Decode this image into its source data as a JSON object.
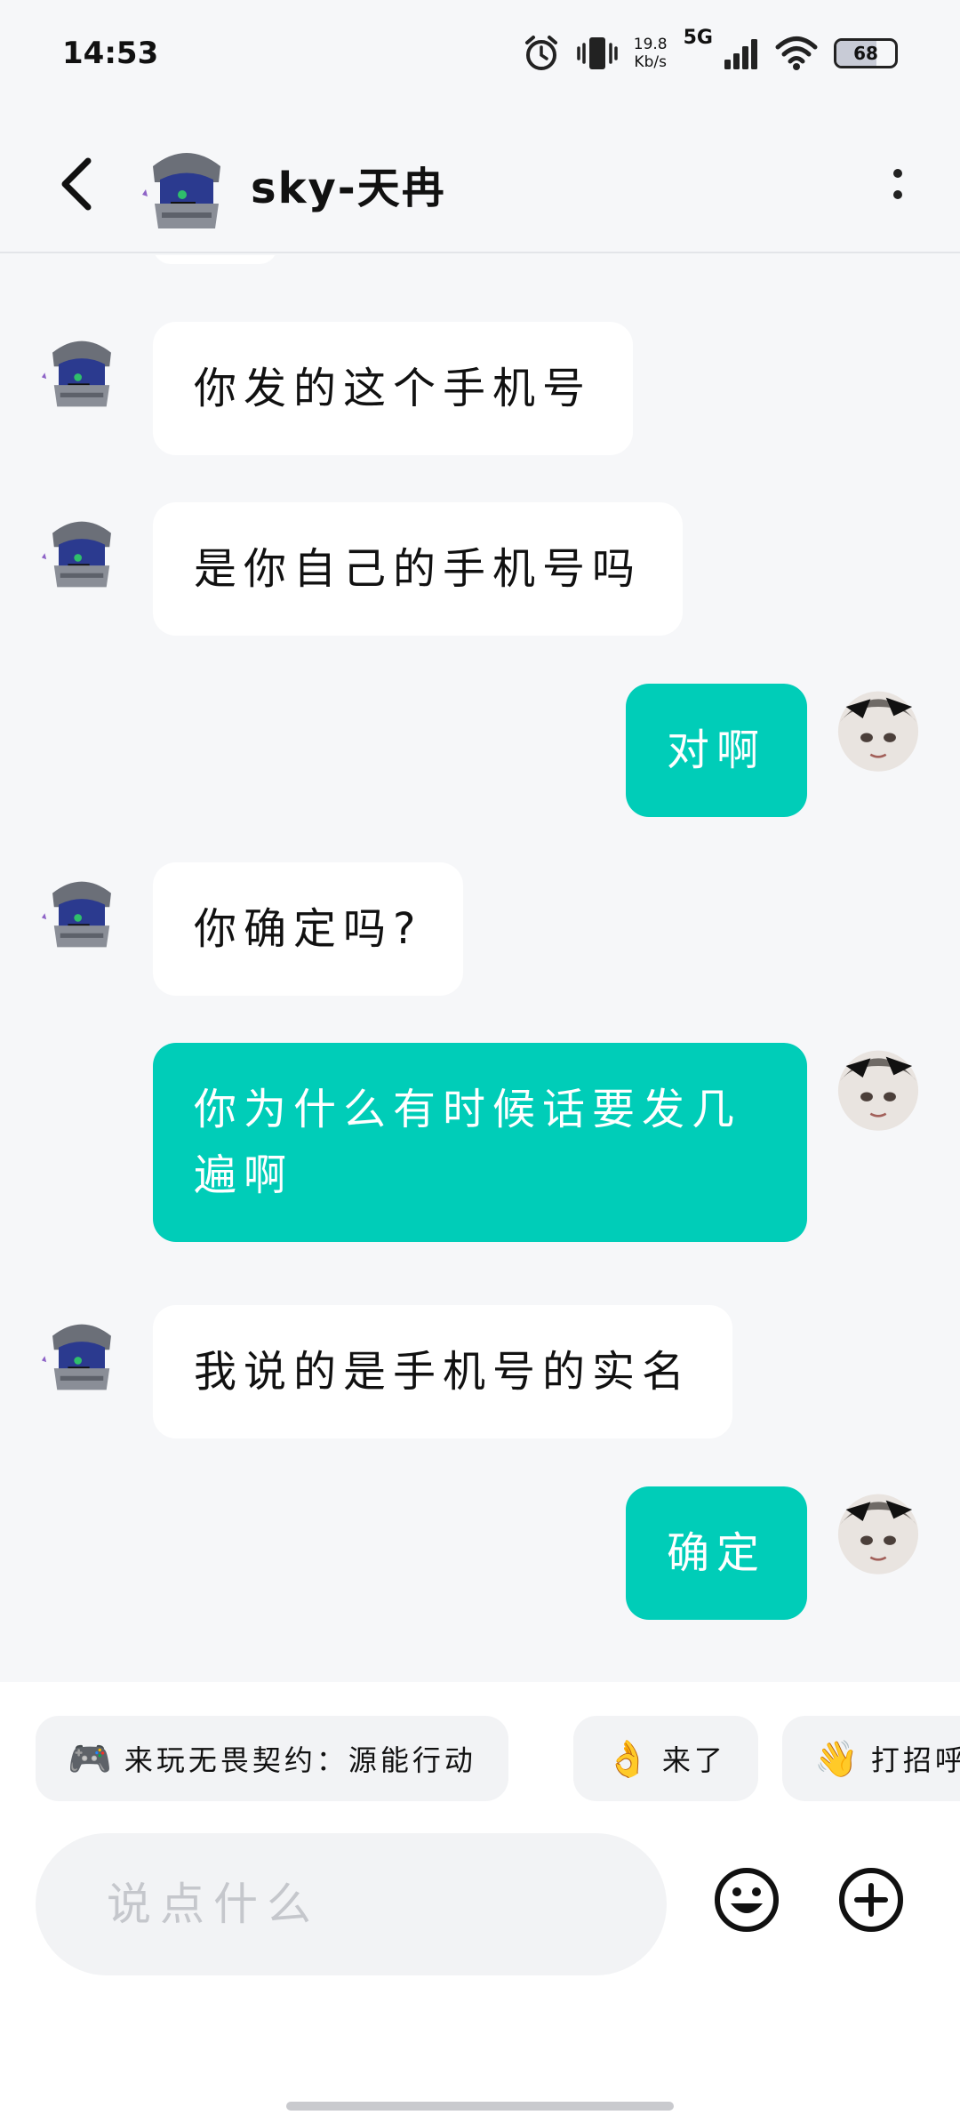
{
  "status_bar": {
    "time": "14:53",
    "net_speed_value": "19.8",
    "net_speed_unit": "Kb/s",
    "network_type": "5G",
    "battery_level": "68",
    "battery_fraction": 0.68,
    "icons": [
      "alarm-icon",
      "vibrate-icon",
      "signal-icon",
      "wifi-icon",
      "battery-icon"
    ]
  },
  "header": {
    "contact_name": "sky-天冉",
    "back_icon": "chevron-left-icon",
    "more_icon": "more-vertical-icon"
  },
  "messages": [
    {
      "side": "left",
      "text": "你发的这个手机号"
    },
    {
      "side": "left",
      "text": "是你自己的手机号吗"
    },
    {
      "side": "right",
      "text": "对啊"
    },
    {
      "side": "left",
      "text": "你确定吗?"
    },
    {
      "side": "right",
      "text": "你为什么有时候话要发几遍啊"
    },
    {
      "side": "left",
      "text": "我说的是手机号的实名"
    },
    {
      "side": "right",
      "text": "确定"
    }
  ],
  "quick_replies": [
    {
      "icon": "🎮",
      "label": "来玩无畏契约：源能行动"
    },
    {
      "icon": "👌",
      "label": "来了"
    },
    {
      "icon": "👋",
      "label": "打招呼"
    }
  ],
  "composer": {
    "placeholder": "说点什么",
    "emoji_icon": "smiley-icon",
    "add_icon": "plus-circle-icon"
  },
  "colors": {
    "sent_bubble": "#00cdb8",
    "received_bubble": "#ffffff",
    "background": "#f6f7f9"
  }
}
